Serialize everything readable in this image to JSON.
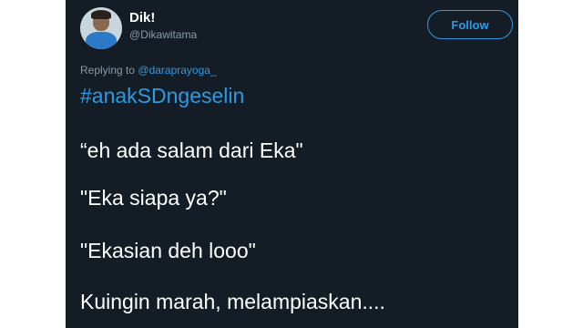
{
  "tweet": {
    "author_name": "Dik!",
    "author_handle": "@Dikawitama",
    "follow_label": "Follow",
    "replying_prefix": "Replying to",
    "replying_mention": "@daraprayoga_",
    "hashtag": "#anakSDngeselin",
    "lines": [
      "“eh ada salam dari Eka\"",
      "\"Eka siapa ya?\"",
      "\"Ekasian deh looo\"",
      "Kuingin marah, melampiaskan...."
    ]
  },
  "colors": {
    "background": "#141d26",
    "accent": "#2b9ae4",
    "text": "#ffffff",
    "muted": "#8899a6"
  }
}
